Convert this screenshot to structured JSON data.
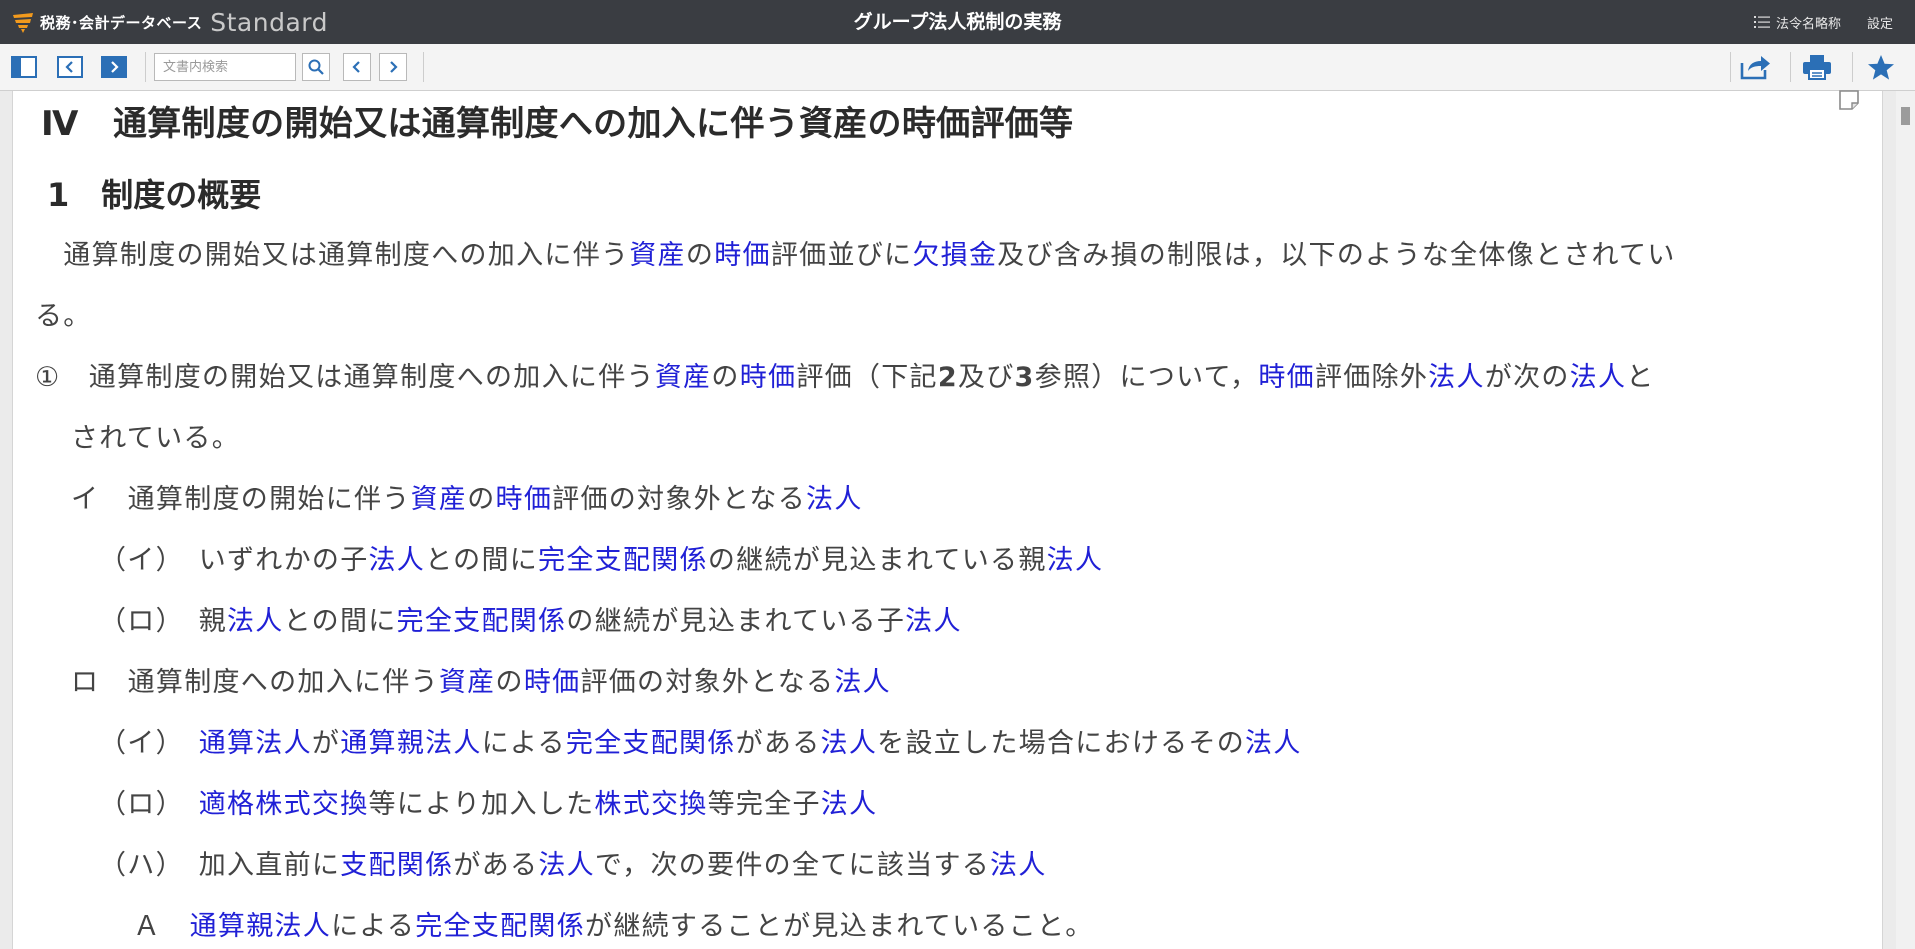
{
  "header": {
    "brand": "税務･会計データベース",
    "edition": "Standard",
    "title": "グループ法人税制の実務",
    "law_abbrev_label": "法令名略称",
    "settings_label": "設定"
  },
  "toolbar": {
    "search_placeholder": "文書内検索",
    "buttons": [
      "toggle-sidebar",
      "collapse-left",
      "expand-right",
      "search",
      "prev-hit",
      "next-hit",
      "share",
      "print",
      "bookmark"
    ]
  },
  "document": {
    "heading": "Ⅳ　通算制度の開始又は通算制度への加入に伴う資産の時価評価等",
    "subheading": "1　制度の概要",
    "lines": [
      {
        "segs": [
          {
            "t": "　通算制度の開始又は通算制度への加入に伴う"
          },
          {
            "t": "資産",
            "link": true
          },
          {
            "t": "の"
          },
          {
            "t": "時価",
            "link": true
          },
          {
            "t": "評価並びに"
          },
          {
            "t": "欠損金",
            "link": true
          },
          {
            "t": "及び含み損の制限は，以下のような全体像とされてい"
          }
        ]
      },
      {
        "segs": [
          {
            "t": "る。"
          }
        ]
      },
      {
        "segs": [
          {
            "t": "①　通算制度の開始又は通算制度への加入に伴う"
          },
          {
            "t": "資産",
            "link": true
          },
          {
            "t": "の"
          },
          {
            "t": "時価",
            "link": true
          },
          {
            "t": "評価（下記"
          },
          {
            "t": "2",
            "bold": true
          },
          {
            "t": "及び"
          },
          {
            "t": "3",
            "bold": true
          },
          {
            "t": "参照）について，"
          },
          {
            "t": "時価",
            "link": true
          },
          {
            "t": "評価除外"
          },
          {
            "t": "法人",
            "link": true
          },
          {
            "t": "が次の"
          },
          {
            "t": "法人",
            "link": true
          },
          {
            "t": "と"
          }
        ]
      },
      {
        "segs": [
          {
            "t": "されている。"
          }
        ]
      },
      {
        "segs": [
          {
            "t": "イ　通算制度の開始に伴う"
          },
          {
            "t": "資産",
            "link": true
          },
          {
            "t": "の"
          },
          {
            "t": "時価",
            "link": true
          },
          {
            "t": "評価の対象外となる"
          },
          {
            "t": "法人",
            "link": true
          }
        ]
      },
      {
        "segs": [
          {
            "t": "（イ）　いずれかの子"
          },
          {
            "t": "法人",
            "link": true
          },
          {
            "t": "との間に"
          },
          {
            "t": "完全支配関係",
            "link": true
          },
          {
            "t": "の継続が見込まれている親"
          },
          {
            "t": "法人",
            "link": true
          }
        ]
      },
      {
        "segs": [
          {
            "t": "（ロ）　親"
          },
          {
            "t": "法人",
            "link": true
          },
          {
            "t": "との間に"
          },
          {
            "t": "完全支配関係",
            "link": true
          },
          {
            "t": "の継続が見込まれている子"
          },
          {
            "t": "法人",
            "link": true
          }
        ]
      },
      {
        "segs": [
          {
            "t": "ロ　通算制度への加入に伴う"
          },
          {
            "t": "資産",
            "link": true
          },
          {
            "t": "の"
          },
          {
            "t": "時価",
            "link": true
          },
          {
            "t": "評価の対象外となる"
          },
          {
            "t": "法人",
            "link": true
          }
        ]
      },
      {
        "segs": [
          {
            "t": "（イ）　"
          },
          {
            "t": "通算法人",
            "link": true
          },
          {
            "t": "が"
          },
          {
            "t": "通算親法人",
            "link": true
          },
          {
            "t": "による"
          },
          {
            "t": "完全支配関係",
            "link": true
          },
          {
            "t": "がある"
          },
          {
            "t": "法人",
            "link": true
          },
          {
            "t": "を設立した場合におけるその"
          },
          {
            "t": "法人",
            "link": true
          }
        ]
      },
      {
        "segs": [
          {
            "t": "（ロ）　"
          },
          {
            "t": "適格株式交換",
            "link": true
          },
          {
            "t": "等により加入した"
          },
          {
            "t": "株式交換",
            "link": true
          },
          {
            "t": "等完全子"
          },
          {
            "t": "法人",
            "link": true
          }
        ]
      },
      {
        "segs": [
          {
            "t": "（ハ）　加入直前に"
          },
          {
            "t": "支配関係",
            "link": true
          },
          {
            "t": "がある"
          },
          {
            "t": "法人",
            "link": true
          },
          {
            "t": "で，次の要件の全てに該当する"
          },
          {
            "t": "法人",
            "link": true
          }
        ]
      },
      {
        "segs": [
          {
            "t": "Ａ　"
          },
          {
            "t": "通算親法人",
            "link": true
          },
          {
            "t": "による"
          },
          {
            "t": "完全支配関係",
            "link": true
          },
          {
            "t": "が継続することが見込まれていること。"
          }
        ]
      }
    ]
  },
  "colors": {
    "topbar": "#3a3d42",
    "link": "#2020d6",
    "accent": "#2b6fb6"
  }
}
